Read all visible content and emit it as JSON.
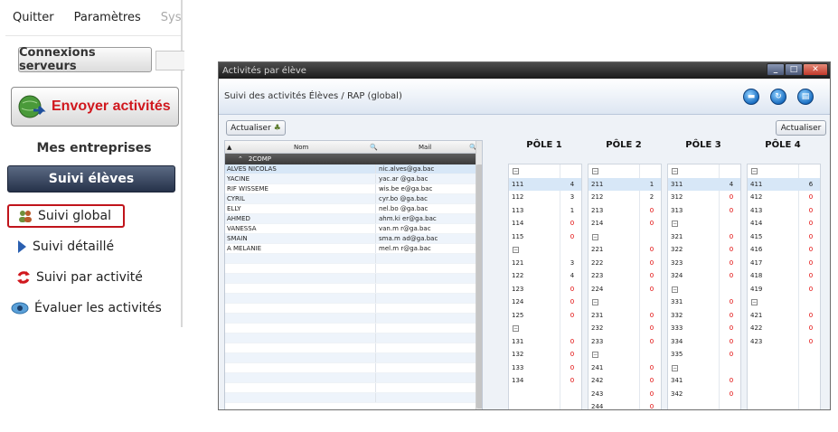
{
  "menu": {
    "quit": "Quitter",
    "settings": "Paramètres",
    "system": "Sys"
  },
  "sidebar": {
    "connect_button": "Connexions serveurs",
    "send_button": "Envoyer activités",
    "companies": "Mes entreprises",
    "section_header": "Suivi élèves",
    "items": [
      {
        "label": "Suivi global",
        "icon": "users-icon"
      },
      {
        "label": "Suivi détaillé",
        "icon": "play-arrow-icon"
      },
      {
        "label": "Suivi par activité",
        "icon": "refresh-arrows-icon"
      },
      {
        "label": "Évaluer les activités",
        "icon": "eye-icon"
      }
    ]
  },
  "window": {
    "title": "Activités par élève",
    "breadcrumb": "Suivi des activités Élèves / RAP (global)",
    "refresh_left": "Actualiser",
    "refresh_right": "Actualiser",
    "col_name": "Nom",
    "col_mail": "Mail",
    "group": "2COMP",
    "students": [
      {
        "name": "ALVES NICOLAS",
        "mail": "nic.alves@ga.bac"
      },
      {
        "name": "YACINE",
        "mail": "yac.ar   @ga.bac"
      },
      {
        "name": "RIF WISSEME",
        "mail": "wis.be    e@ga.bac"
      },
      {
        "name": "CYRIL",
        "mail": "cyr.bo    @ga.bac"
      },
      {
        "name": "ELLY",
        "mail": "nel.bo    @ga.bac"
      },
      {
        "name": "AHMED",
        "mail": "ahm.ki    er@ga.bac"
      },
      {
        "name": "VANESSA",
        "mail": "van.m    r@ga.bac"
      },
      {
        "name": "SMAIN",
        "mail": "sma.m    ad@ga.bac"
      },
      {
        "name": "A MELANIE",
        "mail": "mel.m    r@ga.bac"
      }
    ]
  },
  "poles": [
    {
      "title": "PÔLE 1",
      "rows": [
        {
          "t": "box"
        },
        {
          "k": "111",
          "v": "4"
        },
        {
          "k": "112",
          "v": "3"
        },
        {
          "k": "113",
          "v": "1"
        },
        {
          "k": "114",
          "v": "0"
        },
        {
          "k": "115",
          "v": "0"
        },
        {
          "t": "box"
        },
        {
          "k": "121",
          "v": "3"
        },
        {
          "k": "122",
          "v": "4"
        },
        {
          "k": "123",
          "v": "0"
        },
        {
          "k": "124",
          "v": "0"
        },
        {
          "k": "125",
          "v": "0"
        },
        {
          "t": "box"
        },
        {
          "k": "131",
          "v": "0"
        },
        {
          "k": "132",
          "v": "0"
        },
        {
          "k": "133",
          "v": "0"
        },
        {
          "k": "134",
          "v": "0"
        }
      ]
    },
    {
      "title": "PÔLE 2",
      "rows": [
        {
          "t": "box"
        },
        {
          "k": "211",
          "v": "1"
        },
        {
          "k": "212",
          "v": "2"
        },
        {
          "k": "213",
          "v": "0"
        },
        {
          "k": "214",
          "v": "0"
        },
        {
          "t": "box"
        },
        {
          "k": "221",
          "v": "0"
        },
        {
          "k": "222",
          "v": "0"
        },
        {
          "k": "223",
          "v": "0"
        },
        {
          "k": "224",
          "v": "0"
        },
        {
          "t": "box"
        },
        {
          "k": "231",
          "v": "0"
        },
        {
          "k": "232",
          "v": "0"
        },
        {
          "k": "233",
          "v": "0"
        },
        {
          "t": "box"
        },
        {
          "k": "241",
          "v": "0"
        },
        {
          "k": "242",
          "v": "0"
        },
        {
          "k": "243",
          "v": "0"
        },
        {
          "k": "244",
          "v": "0"
        }
      ]
    },
    {
      "title": "PÔLE 3",
      "rows": [
        {
          "t": "box"
        },
        {
          "k": "311",
          "v": "4"
        },
        {
          "k": "312",
          "v": "0"
        },
        {
          "k": "313",
          "v": "0"
        },
        {
          "t": "box"
        },
        {
          "k": "321",
          "v": "0"
        },
        {
          "k": "322",
          "v": "0"
        },
        {
          "k": "323",
          "v": "0"
        },
        {
          "k": "324",
          "v": "0"
        },
        {
          "t": "box"
        },
        {
          "k": "331",
          "v": "0"
        },
        {
          "k": "332",
          "v": "0"
        },
        {
          "k": "333",
          "v": "0"
        },
        {
          "k": "334",
          "v": "0"
        },
        {
          "k": "335",
          "v": "0"
        },
        {
          "t": "box"
        },
        {
          "k": "341",
          "v": "0"
        },
        {
          "k": "342",
          "v": "0"
        }
      ]
    },
    {
      "title": "PÔLE 4",
      "rows": [
        {
          "t": "box"
        },
        {
          "k": "411",
          "v": "6"
        },
        {
          "k": "412",
          "v": "0"
        },
        {
          "k": "413",
          "v": "0"
        },
        {
          "k": "414",
          "v": "0"
        },
        {
          "k": "415",
          "v": "0"
        },
        {
          "k": "416",
          "v": "0"
        },
        {
          "k": "417",
          "v": "0"
        },
        {
          "k": "418",
          "v": "0"
        },
        {
          "k": "419",
          "v": "0"
        },
        {
          "t": "box"
        },
        {
          "k": "421",
          "v": "0"
        },
        {
          "k": "422",
          "v": "0"
        },
        {
          "k": "423",
          "v": "0"
        }
      ]
    }
  ],
  "colors": {
    "accent": "#d0181e",
    "zero": "#e00000",
    "header_dark": "#26324a"
  }
}
